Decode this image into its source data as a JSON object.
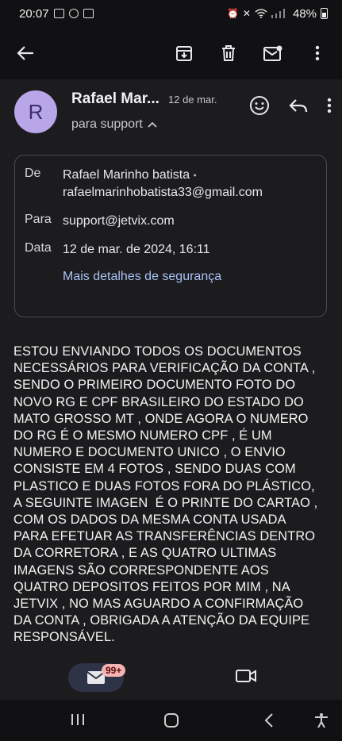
{
  "status_bar": {
    "time": "20:07",
    "battery": "48%"
  },
  "email": {
    "avatar_letter": "R",
    "sender_short": "Rafael Mar...",
    "date_short": "12 de mar.",
    "to_summary": "para support",
    "details": {
      "from_label": "De",
      "from_name": "Rafael Marinho batista",
      "from_sep": "•",
      "from_email": "rafaelmarinhobatista33@gmail.com",
      "to_label": "Para",
      "to_email": "support@jetvix.com",
      "date_label": "Data",
      "date_full": "12 de mar. de 2024, 16:11",
      "security_link": "Mais detalhes de segurança"
    },
    "body_lines": [
      "ESTOU ENVIANDO TODOS OS DOCUMENTOS",
      "NECESSÁRIOS PARA VERIFICAÇÃO DA CONTA ,",
      "SENDO O PRIMEIRO DOCUMENTO FOTO DO",
      "NOVO RG E CPF BRASILEIRO DO ESTADO DO",
      "MATO GROSSO MT , ONDE AGORA O NUMERO",
      "DO RG É O MESMO NUMERO CPF , É UM",
      "NUMERO E DOCUMENTO UNICO , O ENVIO",
      "CONSISTE EM 4 FOTOS , SENDO DUAS COM",
      "PLASTICO E DUAS FOTOS FORA DO PLÁSTICO,",
      "A SEGUINTE IMAGEN  É O PRINTE DO CARTAO ,",
      "COM OS DADOS DA MESMA CONTA USADA",
      "PARA EFETUAR AS TRANSFERÊNCIAS DENTRO",
      "DA CORRETORA , E AS QUATRO ULTIMAS",
      "IMAGENS SÃO CORRESPONDENTE AOS",
      "QUATRO DEPOSITOS FEITOS POR MIM , NA",
      "JETVIX , NO MAS AGUARDO A CONFIRMAÇÃO",
      "DA CONTA , OBRIGADA A ATENÇÃO DA EQUIPE",
      "RESPONSÁVEL."
    ]
  },
  "bottom_nav": {
    "mail_badge": "99+"
  },
  "icons": [
    "back-arrow-icon",
    "archive-icon",
    "trash-icon",
    "mark-unread-icon",
    "more-vert-icon",
    "emoji-icon",
    "reply-icon",
    "mail-icon",
    "video-icon",
    "recents-icon",
    "home-icon",
    "back-icon",
    "accessibility-icon"
  ],
  "colors": {
    "background": "#1c1c1e",
    "link": "#a9c3f5",
    "avatar": "#b8a6e8",
    "badge": "#f3b3b3"
  }
}
